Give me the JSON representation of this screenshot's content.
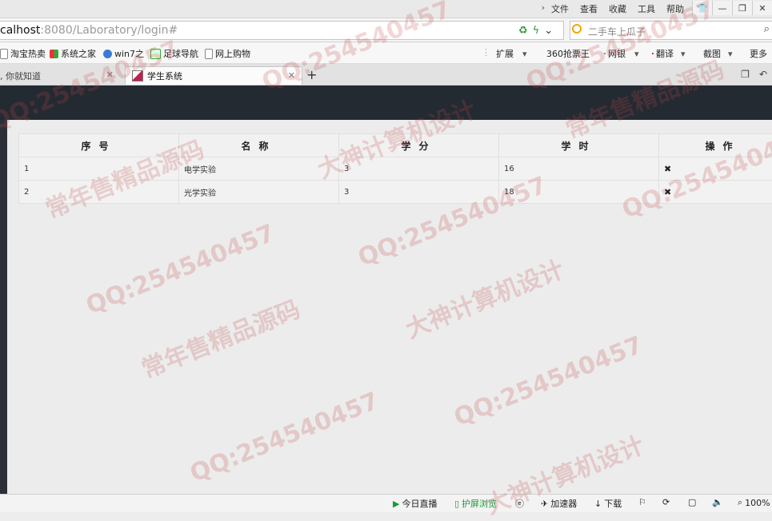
{
  "menu": {
    "items": [
      "文件",
      "查看",
      "收藏",
      "工具",
      "帮助"
    ]
  },
  "address": {
    "host": "calhost",
    "rest": ":8080/Laboratory/login#"
  },
  "search": {
    "placeholder": "二手车上瓜子"
  },
  "bookmarks": {
    "left": [
      "淘宝热卖",
      "系统之家",
      "win7之",
      "足球导航",
      "网上购物"
    ],
    "right": [
      "扩展",
      "360抢票王",
      "网银",
      "翻译",
      "截图",
      "更多"
    ]
  },
  "tabs": {
    "inactive_label": ", 你就知道",
    "active_label": "学生系统"
  },
  "table": {
    "headers": [
      "序号",
      "名称",
      "学分",
      "学时",
      "操作"
    ],
    "rows": [
      {
        "no": "1",
        "name": "电学实验",
        "credit": "3",
        "hours": "16",
        "action": "✖"
      },
      {
        "no": "2",
        "name": "光学实验",
        "credit": "3",
        "hours": "18",
        "action": "✖"
      }
    ]
  },
  "status": {
    "live": "今日直播",
    "protect": "护屏浏览",
    "accelerate": "加速器",
    "download": "下载",
    "zoom": "100%"
  },
  "watermarks": [
    "QQ:254540457",
    "大神计算机设计",
    "常年售精品源码"
  ],
  "colors": {
    "page_header": "#232a32",
    "watermark": "#c44848",
    "status_green": "#1a9a37"
  }
}
